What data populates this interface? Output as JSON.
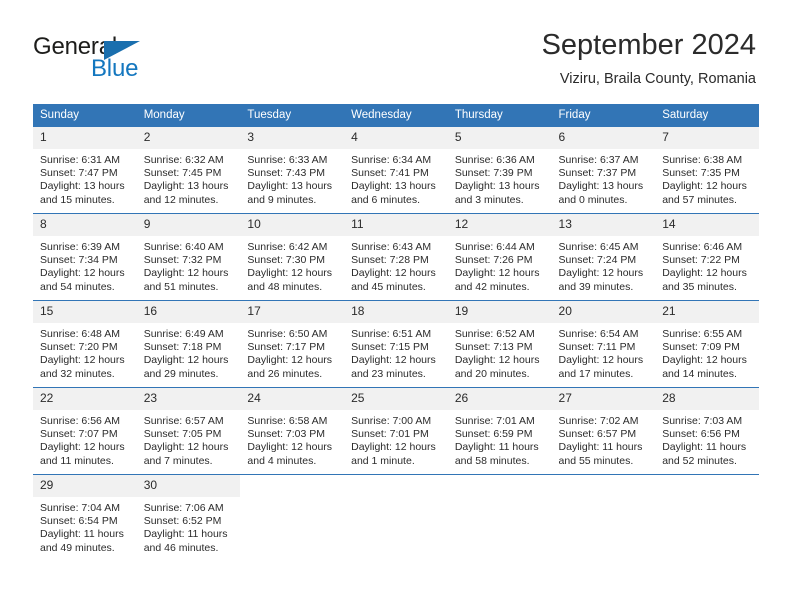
{
  "brand": {
    "line1": "General",
    "line2": "Blue",
    "accent_color": "#1477bf",
    "triangle_color": "#1a6fae"
  },
  "header": {
    "month_title": "September 2024",
    "location": "Viziru, Braila County, Romania"
  },
  "theme": {
    "header_blue": "#3275b6",
    "daynum_bg": "#f1f1f1",
    "text": "#2b2b2b"
  },
  "weekday_headers": [
    "Sunday",
    "Monday",
    "Tuesday",
    "Wednesday",
    "Thursday",
    "Friday",
    "Saturday"
  ],
  "weeks": [
    [
      {
        "day": "1",
        "sunrise": "Sunrise: 6:31 AM",
        "sunset": "Sunset: 7:47 PM",
        "daylight_1": "Daylight: 13 hours",
        "daylight_2": "and 15 minutes."
      },
      {
        "day": "2",
        "sunrise": "Sunrise: 6:32 AM",
        "sunset": "Sunset: 7:45 PM",
        "daylight_1": "Daylight: 13 hours",
        "daylight_2": "and 12 minutes."
      },
      {
        "day": "3",
        "sunrise": "Sunrise: 6:33 AM",
        "sunset": "Sunset: 7:43 PM",
        "daylight_1": "Daylight: 13 hours",
        "daylight_2": "and 9 minutes."
      },
      {
        "day": "4",
        "sunrise": "Sunrise: 6:34 AM",
        "sunset": "Sunset: 7:41 PM",
        "daylight_1": "Daylight: 13 hours",
        "daylight_2": "and 6 minutes."
      },
      {
        "day": "5",
        "sunrise": "Sunrise: 6:36 AM",
        "sunset": "Sunset: 7:39 PM",
        "daylight_1": "Daylight: 13 hours",
        "daylight_2": "and 3 minutes."
      },
      {
        "day": "6",
        "sunrise": "Sunrise: 6:37 AM",
        "sunset": "Sunset: 7:37 PM",
        "daylight_1": "Daylight: 13 hours",
        "daylight_2": "and 0 minutes."
      },
      {
        "day": "7",
        "sunrise": "Sunrise: 6:38 AM",
        "sunset": "Sunset: 7:35 PM",
        "daylight_1": "Daylight: 12 hours",
        "daylight_2": "and 57 minutes."
      }
    ],
    [
      {
        "day": "8",
        "sunrise": "Sunrise: 6:39 AM",
        "sunset": "Sunset: 7:34 PM",
        "daylight_1": "Daylight: 12 hours",
        "daylight_2": "and 54 minutes."
      },
      {
        "day": "9",
        "sunrise": "Sunrise: 6:40 AM",
        "sunset": "Sunset: 7:32 PM",
        "daylight_1": "Daylight: 12 hours",
        "daylight_2": "and 51 minutes."
      },
      {
        "day": "10",
        "sunrise": "Sunrise: 6:42 AM",
        "sunset": "Sunset: 7:30 PM",
        "daylight_1": "Daylight: 12 hours",
        "daylight_2": "and 48 minutes."
      },
      {
        "day": "11",
        "sunrise": "Sunrise: 6:43 AM",
        "sunset": "Sunset: 7:28 PM",
        "daylight_1": "Daylight: 12 hours",
        "daylight_2": "and 45 minutes."
      },
      {
        "day": "12",
        "sunrise": "Sunrise: 6:44 AM",
        "sunset": "Sunset: 7:26 PM",
        "daylight_1": "Daylight: 12 hours",
        "daylight_2": "and 42 minutes."
      },
      {
        "day": "13",
        "sunrise": "Sunrise: 6:45 AM",
        "sunset": "Sunset: 7:24 PM",
        "daylight_1": "Daylight: 12 hours",
        "daylight_2": "and 39 minutes."
      },
      {
        "day": "14",
        "sunrise": "Sunrise: 6:46 AM",
        "sunset": "Sunset: 7:22 PM",
        "daylight_1": "Daylight: 12 hours",
        "daylight_2": "and 35 minutes."
      }
    ],
    [
      {
        "day": "15",
        "sunrise": "Sunrise: 6:48 AM",
        "sunset": "Sunset: 7:20 PM",
        "daylight_1": "Daylight: 12 hours",
        "daylight_2": "and 32 minutes."
      },
      {
        "day": "16",
        "sunrise": "Sunrise: 6:49 AM",
        "sunset": "Sunset: 7:18 PM",
        "daylight_1": "Daylight: 12 hours",
        "daylight_2": "and 29 minutes."
      },
      {
        "day": "17",
        "sunrise": "Sunrise: 6:50 AM",
        "sunset": "Sunset: 7:17 PM",
        "daylight_1": "Daylight: 12 hours",
        "daylight_2": "and 26 minutes."
      },
      {
        "day": "18",
        "sunrise": "Sunrise: 6:51 AM",
        "sunset": "Sunset: 7:15 PM",
        "daylight_1": "Daylight: 12 hours",
        "daylight_2": "and 23 minutes."
      },
      {
        "day": "19",
        "sunrise": "Sunrise: 6:52 AM",
        "sunset": "Sunset: 7:13 PM",
        "daylight_1": "Daylight: 12 hours",
        "daylight_2": "and 20 minutes."
      },
      {
        "day": "20",
        "sunrise": "Sunrise: 6:54 AM",
        "sunset": "Sunset: 7:11 PM",
        "daylight_1": "Daylight: 12 hours",
        "daylight_2": "and 17 minutes."
      },
      {
        "day": "21",
        "sunrise": "Sunrise: 6:55 AM",
        "sunset": "Sunset: 7:09 PM",
        "daylight_1": "Daylight: 12 hours",
        "daylight_2": "and 14 minutes."
      }
    ],
    [
      {
        "day": "22",
        "sunrise": "Sunrise: 6:56 AM",
        "sunset": "Sunset: 7:07 PM",
        "daylight_1": "Daylight: 12 hours",
        "daylight_2": "and 11 minutes."
      },
      {
        "day": "23",
        "sunrise": "Sunrise: 6:57 AM",
        "sunset": "Sunset: 7:05 PM",
        "daylight_1": "Daylight: 12 hours",
        "daylight_2": "and 7 minutes."
      },
      {
        "day": "24",
        "sunrise": "Sunrise: 6:58 AM",
        "sunset": "Sunset: 7:03 PM",
        "daylight_1": "Daylight: 12 hours",
        "daylight_2": "and 4 minutes."
      },
      {
        "day": "25",
        "sunrise": "Sunrise: 7:00 AM",
        "sunset": "Sunset: 7:01 PM",
        "daylight_1": "Daylight: 12 hours",
        "daylight_2": "and 1 minute."
      },
      {
        "day": "26",
        "sunrise": "Sunrise: 7:01 AM",
        "sunset": "Sunset: 6:59 PM",
        "daylight_1": "Daylight: 11 hours",
        "daylight_2": "and 58 minutes."
      },
      {
        "day": "27",
        "sunrise": "Sunrise: 7:02 AM",
        "sunset": "Sunset: 6:57 PM",
        "daylight_1": "Daylight: 11 hours",
        "daylight_2": "and 55 minutes."
      },
      {
        "day": "28",
        "sunrise": "Sunrise: 7:03 AM",
        "sunset": "Sunset: 6:56 PM",
        "daylight_1": "Daylight: 11 hours",
        "daylight_2": "and 52 minutes."
      }
    ],
    [
      {
        "day": "29",
        "sunrise": "Sunrise: 7:04 AM",
        "sunset": "Sunset: 6:54 PM",
        "daylight_1": "Daylight: 11 hours",
        "daylight_2": "and 49 minutes."
      },
      {
        "day": "30",
        "sunrise": "Sunrise: 7:06 AM",
        "sunset": "Sunset: 6:52 PM",
        "daylight_1": "Daylight: 11 hours",
        "daylight_2": "and 46 minutes."
      },
      {
        "day": "",
        "sunrise": "",
        "sunset": "",
        "daylight_1": "",
        "daylight_2": ""
      },
      {
        "day": "",
        "sunrise": "",
        "sunset": "",
        "daylight_1": "",
        "daylight_2": ""
      },
      {
        "day": "",
        "sunrise": "",
        "sunset": "",
        "daylight_1": "",
        "daylight_2": ""
      },
      {
        "day": "",
        "sunrise": "",
        "sunset": "",
        "daylight_1": "",
        "daylight_2": ""
      },
      {
        "day": "",
        "sunrise": "",
        "sunset": "",
        "daylight_1": "",
        "daylight_2": ""
      }
    ]
  ]
}
